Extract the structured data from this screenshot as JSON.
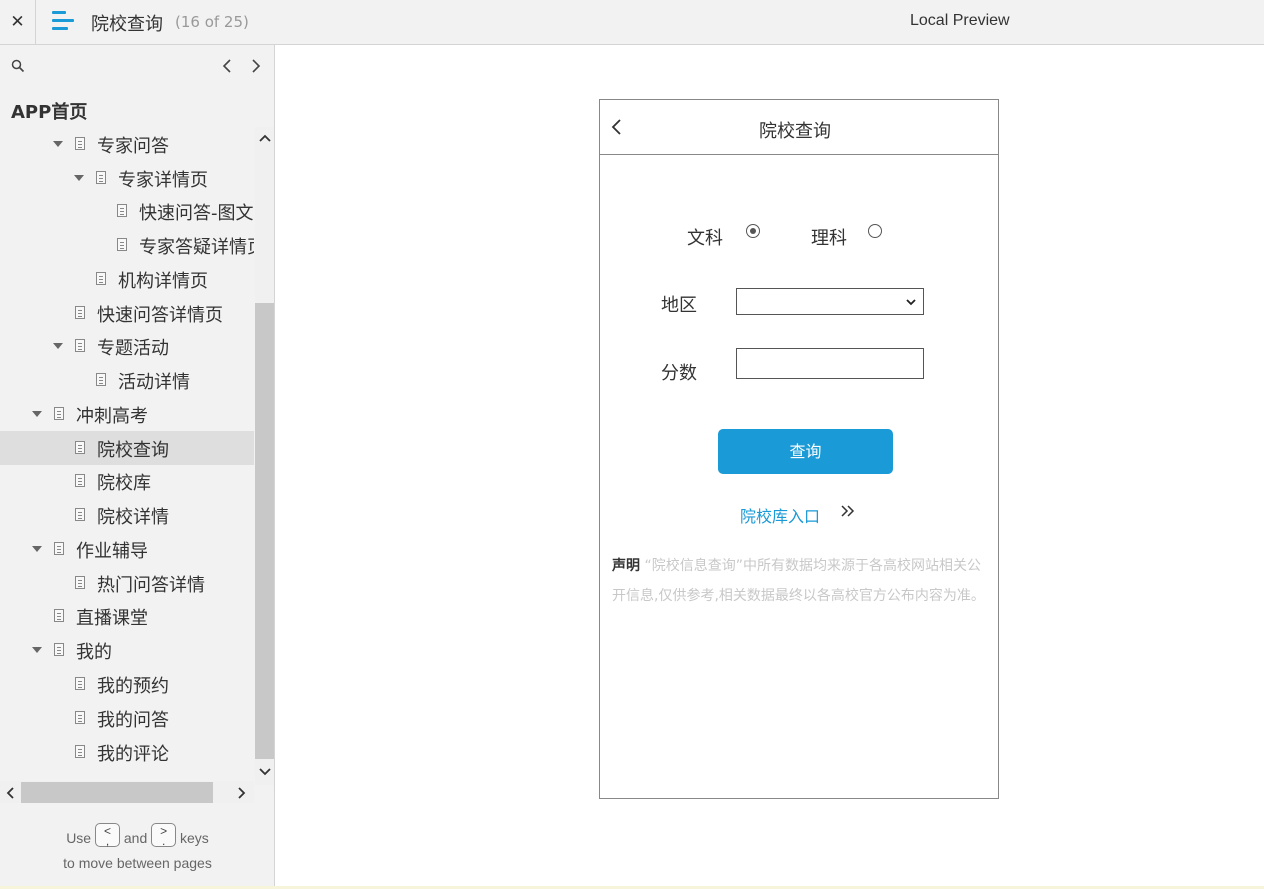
{
  "topbar": {
    "close_glyph": "✕",
    "title": "院校查询",
    "page_count": "(16 of 25)",
    "preview_label": "Local Preview"
  },
  "sidebar": {
    "root_title": "APP首页",
    "items": [
      {
        "label": "专家问答",
        "expanded": true
      },
      {
        "label": "专家详情页",
        "expanded": true
      },
      {
        "label": "快速问答-图文"
      },
      {
        "label": "专家答疑详情页"
      },
      {
        "label": "机构详情页"
      },
      {
        "label": "快速问答详情页"
      },
      {
        "label": "专题活动",
        "expanded": true
      },
      {
        "label": "活动详情"
      },
      {
        "label": "冲刺高考",
        "expanded": true
      },
      {
        "label": "院校查询",
        "selected": true
      },
      {
        "label": "院校库"
      },
      {
        "label": "院校详情"
      },
      {
        "label": "作业辅导",
        "expanded": true
      },
      {
        "label": "热门问答详情"
      },
      {
        "label": "直播课堂"
      },
      {
        "label": "我的",
        "expanded": true
      },
      {
        "label": "我的预约"
      },
      {
        "label": "我的问答"
      },
      {
        "label": "我的评论"
      }
    ],
    "hint": {
      "use": "Use",
      "key_prev": "<",
      "key_prev_sub": ",",
      "and": "and",
      "key_next": ">",
      "key_next_sub": ".",
      "keys": "keys",
      "line2": "to move between pages"
    }
  },
  "phone": {
    "title": "院校查询",
    "radio_arts": "文科",
    "radio_science": "理科",
    "selected_track": "文科",
    "region_label": "地区",
    "region_value": "",
    "score_label": "分数",
    "score_value": "",
    "query_button": "查询",
    "library_link": "院校库入口",
    "notice_title": "声明",
    "notice_text": " “院校信息查询”中所有数据均来源于各高校网站相关公开信息,仅供参考,相关数据最终以各高校官方公布内容为准。"
  },
  "colors": {
    "accent": "#1a9ad6",
    "sidebar_bg": "#f2f2f2",
    "selected_bg": "#dedede",
    "notice_text": "#c8c8c8"
  }
}
